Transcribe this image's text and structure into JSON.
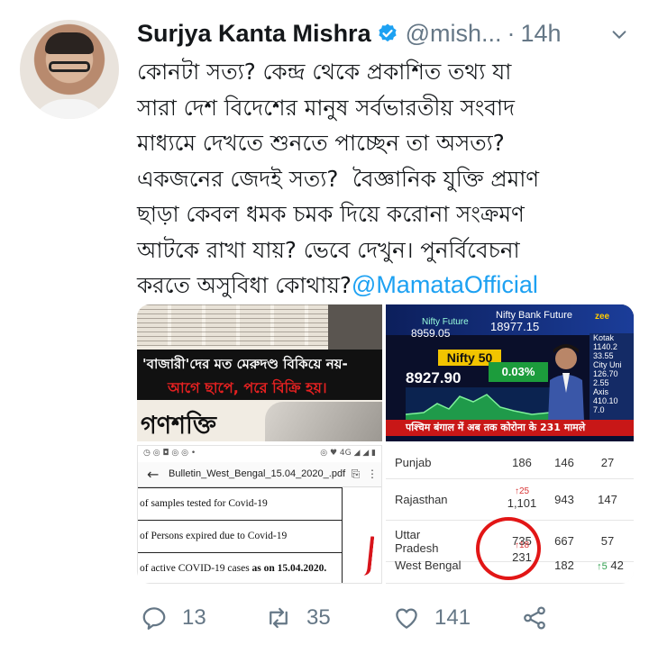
{
  "author": {
    "name": "Surjya Kanta Mishra",
    "handle": "@mish...",
    "separator": "·",
    "time": "14h"
  },
  "tweet": {
    "text": "কোনটা সত্য? কেন্দ্র থেকে প্রকাশিত তথ্য যা\nসারা দেশ বিদেশের মানুষ সর্বভারতীয় সংবাদ\nমাধ্যমে দেখতে শুনতে পাচ্ছেন তা অসত্য?\nএকজনের জেদই সত্য?  বৈজ্ঞানিক যুক্তি প্রমাণ\nছাড়া কেবল ধমক চমক দিয়ে করোনা সংক্রমণ\nআটকে রাখা যায়? ভেবে দেখুন। পুনর্বিবেচনা\nকরতে অসুবিধা কোথায়?",
    "mention": "@MamataOfficial"
  },
  "media": {
    "newspaper": {
      "headline_white": "'বাজারী'দের মত মেরুদণ্ড বিকিয়ে নয়-",
      "headline_red": "আগে ছাপে, পরে বিক্রি হয়।",
      "logo": "গণশক্তি"
    },
    "tv": {
      "nifty_future_label": "Nifty Future",
      "nifty_future_value": "8959.05",
      "bank_future_label": "Nifty Bank Future",
      "bank_future_value": "18977.15",
      "nifty50_label": "Nifty 50",
      "price": "8927.90",
      "change": "0.03%",
      "channel": "zee",
      "side_lines": [
        "Kotak",
        "1140.2",
        "33.55",
        "City Uni",
        "126.70",
        "2.55",
        "Axis",
        "410.10",
        "7.0"
      ],
      "ticker": "पश्चिम बंगाल में अब तक कोरोना के 231 मामले"
    },
    "pdf": {
      "status_left": "◷ ◎ ◘ ◎ ◎ •",
      "status_right": "◎ ♥ 4G ◢ ◢ ▮",
      "title": "Bulletin_West_Bengal_15.04_2020_.pdf",
      "row1": "of samples tested for  Covid-19",
      "row2": "of Persons expired due to Covid-19",
      "row3_normal": "of active COVID-19 cases ",
      "row3_bold": "as on 15.04.2020."
    },
    "table": {
      "rows": [
        {
          "state": "Punjab",
          "delta": "",
          "c1": "186",
          "c2": "146",
          "c3": "27",
          "c3_delta": ""
        },
        {
          "state": "Rajasthan",
          "delta": "↑25",
          "c1": "1,101",
          "c2": "943",
          "c3": "147",
          "c3_delta": ""
        },
        {
          "state": "Uttar\nPradesh",
          "delta": "",
          "c1": "735",
          "c2": "667",
          "c3": "57",
          "c3_delta": ""
        },
        {
          "state": "West Bengal",
          "delta": "↑18",
          "c1": "231",
          "c2": "182",
          "c3": "42",
          "c3_delta": "↑5"
        }
      ]
    }
  },
  "actions": {
    "replies": "13",
    "retweets": "35",
    "likes": "141"
  },
  "colors": {
    "link": "#1da1f2",
    "muted": "#657786",
    "text": "#14171a"
  }
}
